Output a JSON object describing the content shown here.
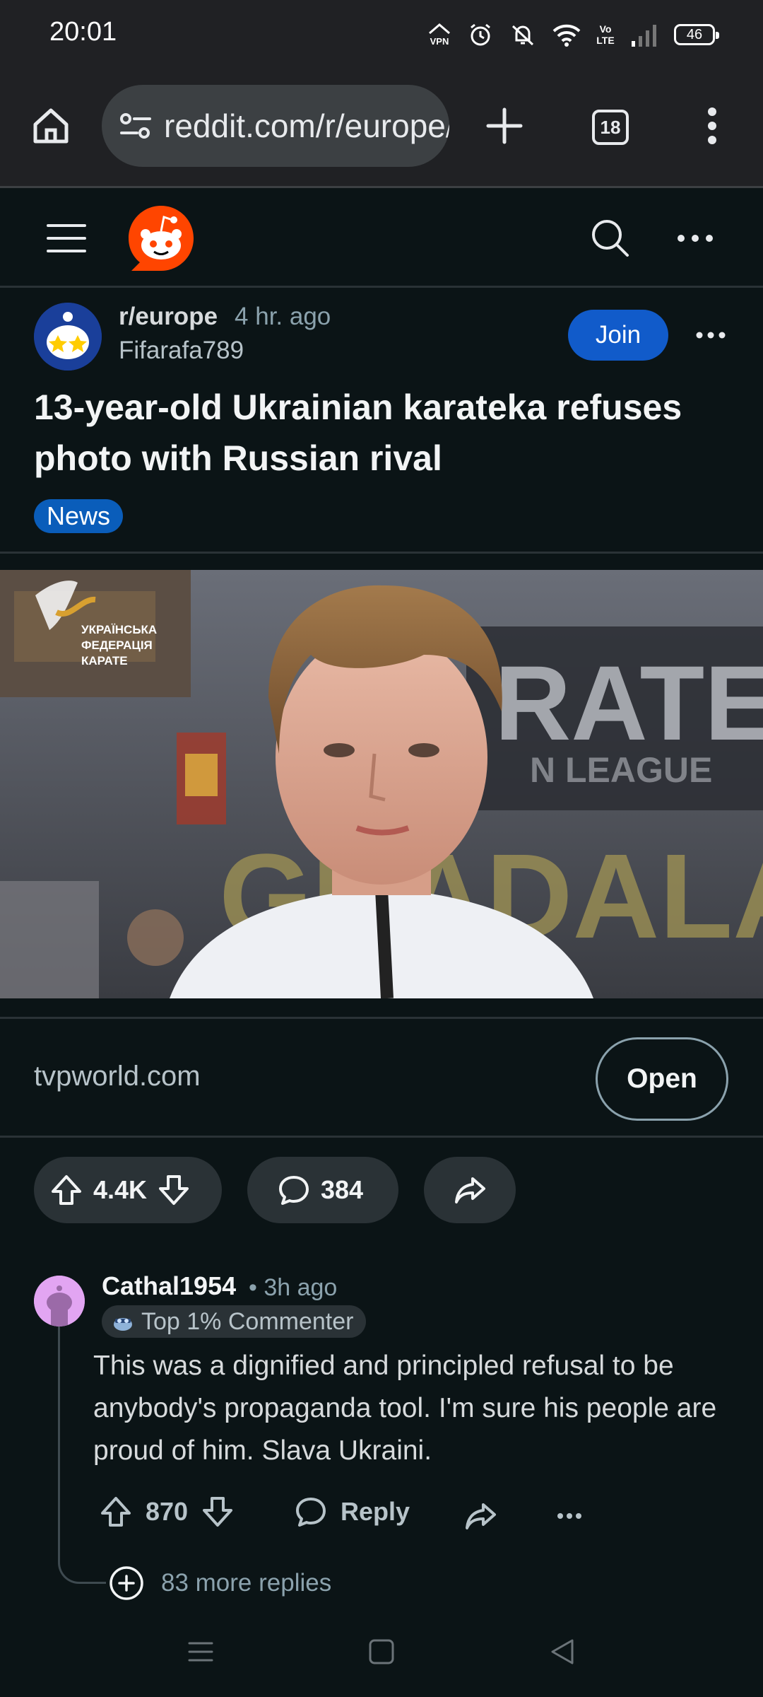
{
  "status_bar": {
    "time": "20:01",
    "battery": "46",
    "icons": [
      "vpn-icon",
      "alarm-icon",
      "mute-icon",
      "wifi-icon",
      "volte-icon",
      "signal-icon",
      "battery-icon"
    ]
  },
  "browser": {
    "url": "reddit.com/r/europe/comments",
    "tab_count": "18"
  },
  "post": {
    "subreddit": "r/europe",
    "time": "4 hr. ago",
    "author": "Fifarafa789",
    "join_label": "Join",
    "title": "13-year-old Ukrainian karateka refuses photo with Russian rival",
    "flair": "News",
    "image_watermark": [
      "УКРАЇНСЬКА",
      "ФЕДЕРАЦІЯ",
      "КАРАТЕ"
    ],
    "domain": "tvpworld.com",
    "open_label": "Open",
    "votes": "4.4K",
    "comments": "384"
  },
  "comment": {
    "user": "Cathal1954",
    "time": "• 3h ago",
    "badge": "Top 1% Commenter",
    "body": "This was a dignified and principled refusal to be anybody's propaganda tool. I'm sure his people are proud of him. Slava Ukraini.",
    "votes": "870",
    "reply_label": "Reply",
    "more_replies": "83 more replies"
  },
  "colors": {
    "background": "#0b1416",
    "join_button": "#115bca",
    "flair": "#0a5dba",
    "action_pill": "#2a3236",
    "reddit_orange": "#ff4500"
  }
}
